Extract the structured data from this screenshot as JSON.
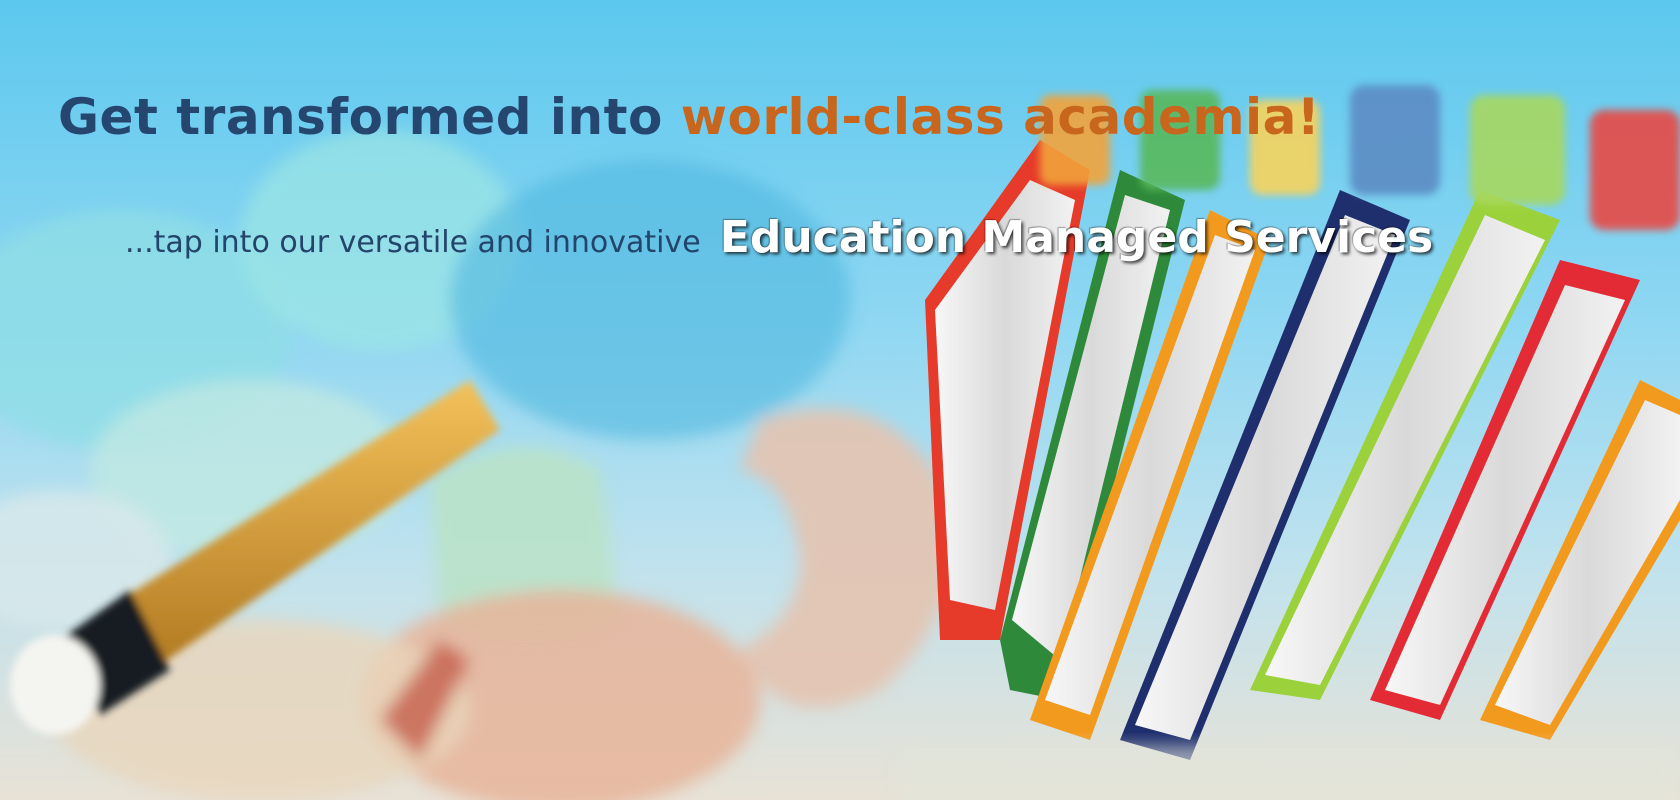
{
  "banner": {
    "headline_dark": "Get transformed into",
    "headline_accent": "world-class academia!",
    "tagline_lead": "...tap into our versatile and innovative",
    "tagline_services": "Education Managed Services"
  },
  "colors": {
    "sky": "#5cc8ee",
    "headline_dark": "#25476f",
    "headline_accent": "#c8661e",
    "services_text": "#ffffff"
  },
  "illustration": {
    "elements": [
      "blurred-puzzle-pieces",
      "pencil",
      "row-of-books"
    ],
    "book_edge_colors": [
      "#e63b2a",
      "#2e8a3a",
      "#f29a1e",
      "#1f2f6e",
      "#9bd13a",
      "#e32b35",
      "#f29a1e"
    ]
  }
}
